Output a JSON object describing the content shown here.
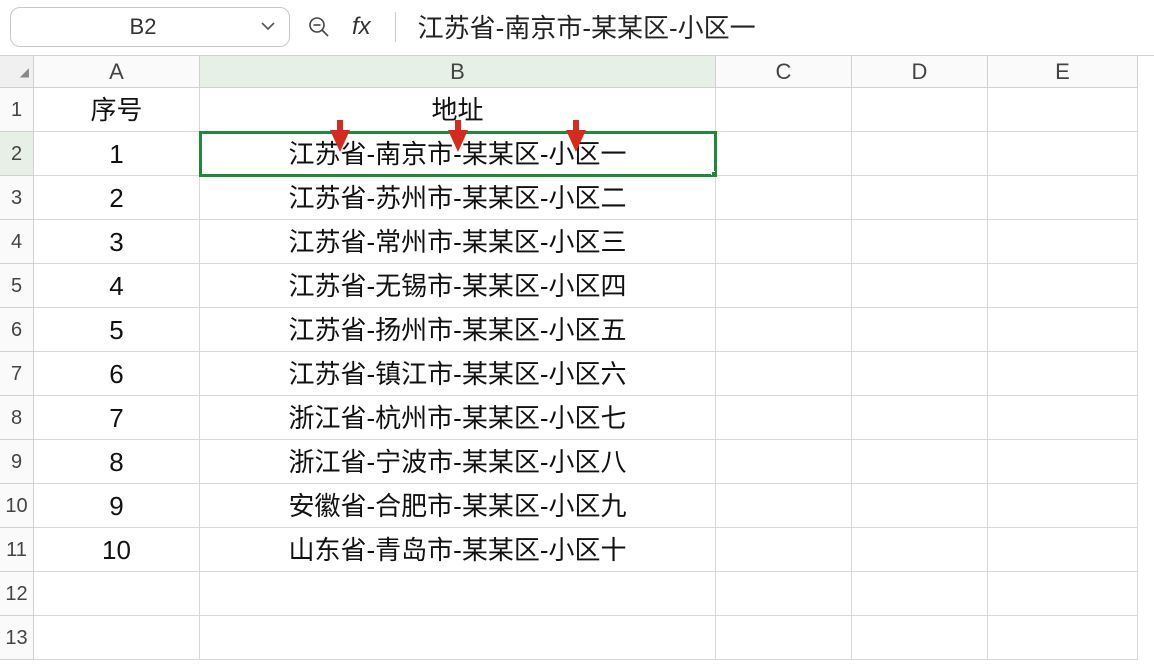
{
  "formula_bar": {
    "cell_reference": "B2",
    "fx_label": "fx",
    "formula_value": "江苏省-南京市-某某区-小区一"
  },
  "columns": [
    "A",
    "B",
    "C",
    "D",
    "E"
  ],
  "row_numbers": [
    1,
    2,
    3,
    4,
    5,
    6,
    7,
    8,
    9,
    10,
    11,
    12,
    13
  ],
  "headers": {
    "A": "序号",
    "B": "地址"
  },
  "selected_cell": "B2",
  "chart_data": {
    "type": "table",
    "columns": [
      "序号",
      "地址"
    ],
    "rows": [
      [
        1,
        "江苏省-南京市-某某区-小区一"
      ],
      [
        2,
        "江苏省-苏州市-某某区-小区二"
      ],
      [
        3,
        "江苏省-常州市-某某区-小区三"
      ],
      [
        4,
        "江苏省-无锡市-某某区-小区四"
      ],
      [
        5,
        "江苏省-扬州市-某某区-小区五"
      ],
      [
        6,
        "江苏省-镇江市-某某区-小区六"
      ],
      [
        7,
        "浙江省-杭州市-某某区-小区七"
      ],
      [
        8,
        "浙江省-宁波市-某某区-小区八"
      ],
      [
        9,
        "安徽省-合肥市-某某区-小区九"
      ],
      [
        10,
        "山东省-青岛市-某某区-小区十"
      ]
    ]
  },
  "annotation": {
    "arrow_count": 3,
    "arrow_color": "#d62a1f",
    "arrow_targets": [
      "first-dash",
      "second-dash",
      "third-dash"
    ]
  }
}
